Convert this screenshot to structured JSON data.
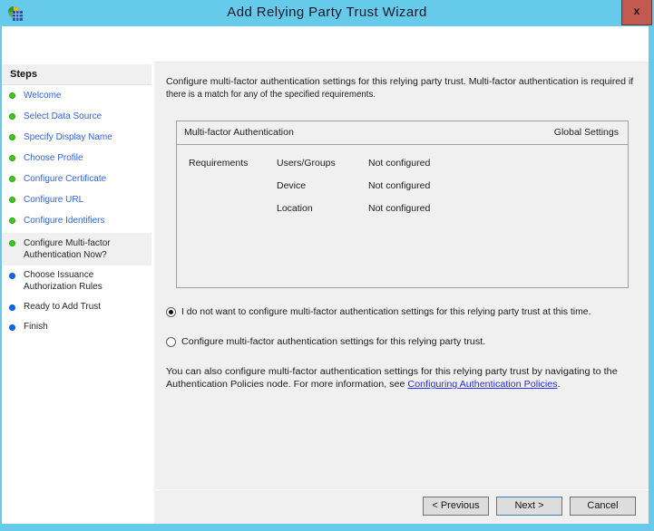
{
  "window": {
    "title": "Add Relying Party Trust Wizard",
    "close": "x"
  },
  "sidebar": {
    "heading": "Steps",
    "steps": [
      {
        "label": "Welcome",
        "state": "done"
      },
      {
        "label": "Select Data Source",
        "state": "done"
      },
      {
        "label": "Specify Display Name",
        "state": "done"
      },
      {
        "label": "Choose Profile",
        "state": "done"
      },
      {
        "label": "Configure Certificate",
        "state": "done"
      },
      {
        "label": "Configure URL",
        "state": "done"
      },
      {
        "label": "Configure Identifiers",
        "state": "done"
      },
      {
        "label": "Configure Multi-factor Authentication Now?",
        "state": "current"
      },
      {
        "label": "Choose Issuance Authorization Rules",
        "state": "future"
      },
      {
        "label": "Ready to Add Trust",
        "state": "future"
      },
      {
        "label": "Finish",
        "state": "future"
      }
    ]
  },
  "main": {
    "intro_lines": [
      "Configure multi-factor authentication settings for this relying party trust. Multi-factor authentication is required if",
      "there is a match for any of the specified requirements."
    ],
    "panel": {
      "header_left": "Multi-factor Authentication",
      "header_right": "Global Settings",
      "rows": [
        {
          "c1": "Requirements",
          "c2": "Users/Groups",
          "c3": "Not configured"
        },
        {
          "c1": "",
          "c2": "Device",
          "c3": "Not configured"
        },
        {
          "c1": "",
          "c2": "Location",
          "c3": "Not configured"
        }
      ]
    },
    "radios": [
      {
        "label": "I do not want to configure multi-factor authentication settings for this relying party trust at this time.",
        "selected": true
      },
      {
        "label": "Configure multi-factor authentication settings for this relying party trust.",
        "selected": false
      }
    ],
    "footnote_line1": "You can also configure multi-factor authentication settings for this relying party trust by navigating to the",
    "footnote_line2_prefix": "Authentication Policies node. For more information, see ",
    "footnote_link": "Configuring Authentication Policies",
    "footnote_suffix": "."
  },
  "buttons": {
    "previous": "< Previous",
    "next": "Next >",
    "cancel": "Cancel"
  }
}
